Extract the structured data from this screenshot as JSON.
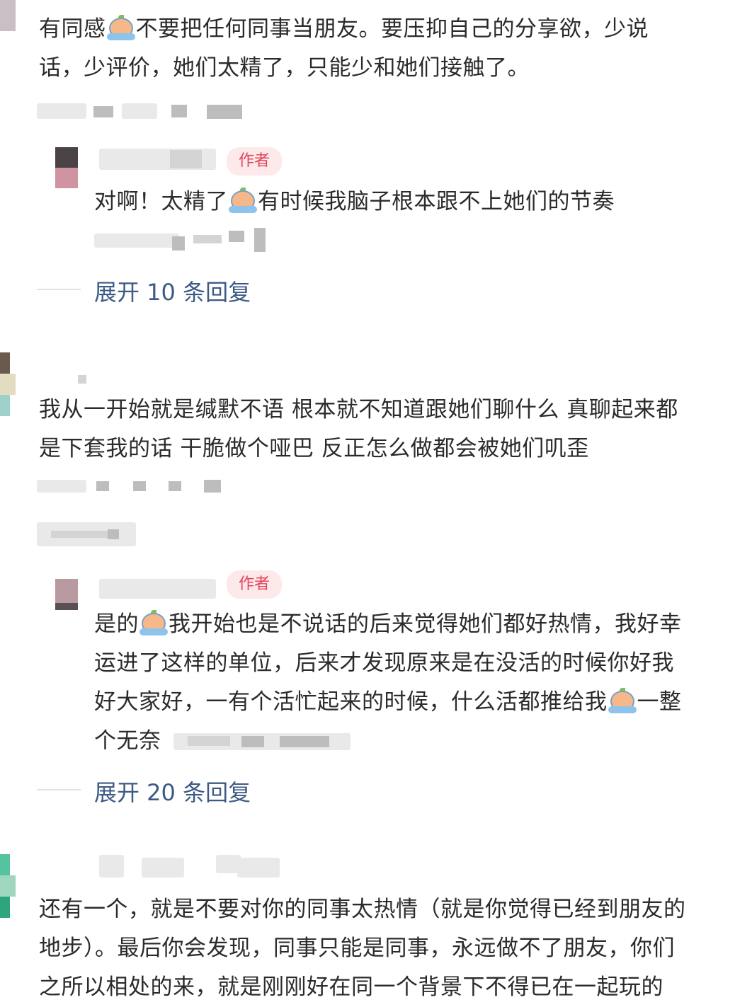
{
  "comments": [
    {
      "text_lines": [
        "有同感",
        "不要把任何同事当朋友。要压抑自己的分享欲，少说",
        "话，少评价，她们太精了，只能少和她们接触了。"
      ],
      "meta": "2024-02-02 回复",
      "replies": [
        {
          "badge": "作者",
          "text_line1_a": "对啊！太精了",
          "text_line1_b": "有时候我脑子根本跟不上她们的节奏",
          "meta": "2024-02"
        }
      ],
      "expand": "展开 10 条回复"
    },
    {
      "text_lines": [
        "我从一开始就是缄默不语 根本就不知道跟她们聊什么 真聊起来都",
        "是下套我的话 干脆做个哑巴 反正怎么做都会被她们叽歪"
      ],
      "meta": "回复",
      "replies": [
        {
          "badge": "作者",
          "line1_a": "是的",
          "line1_b": "我开始也是不说话的后来觉得她们都好热情，我好幸",
          "line2": "运进了这样的单位，后来才发现原来是在没活的时候你好我",
          "line3_a": "好大家好，一有个活忙起来的时候，什么活都推给我",
          "line3_b": "一整",
          "line4": "个无奈"
        }
      ],
      "expand": "展开 20 条回复"
    },
    {
      "text_lines": [
        "还有一个，就是不要对你的同事太热情（就是你觉得已经到朋友的",
        "地步）。最后你会发现，同事只能是同事，永远做不了朋友，你们",
        "之所以相处的来，就是刚刚好在同一个背景下不得已在一起玩的"
      ]
    }
  ]
}
